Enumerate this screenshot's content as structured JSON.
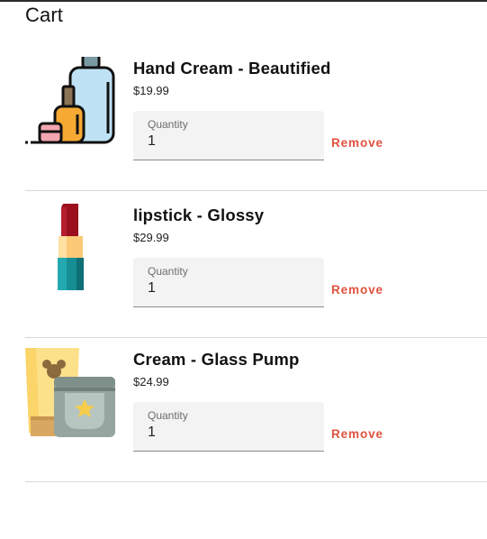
{
  "page": {
    "title": "Cart"
  },
  "cart": {
    "items": [
      {
        "name": "Hand Cream - Beautified",
        "price": "$19.99",
        "quantity_label": "Quantity",
        "quantity": "1",
        "remove_label": "Remove",
        "image_icon": "hand-cream-bottles"
      },
      {
        "name": "lipstick - Glossy",
        "price": "$29.99",
        "quantity_label": "Quantity",
        "quantity": "1",
        "remove_label": "Remove",
        "image_icon": "lipstick"
      },
      {
        "name": "Cream - Glass Pump",
        "price": "$24.99",
        "quantity_label": "Quantity",
        "quantity": "1",
        "remove_label": "Remove",
        "image_icon": "cream-jar-and-tube"
      }
    ]
  },
  "colors": {
    "accent_remove": "#e0523f",
    "divider": "#d8d8d8",
    "field_bg": "#f3f3f3"
  }
}
